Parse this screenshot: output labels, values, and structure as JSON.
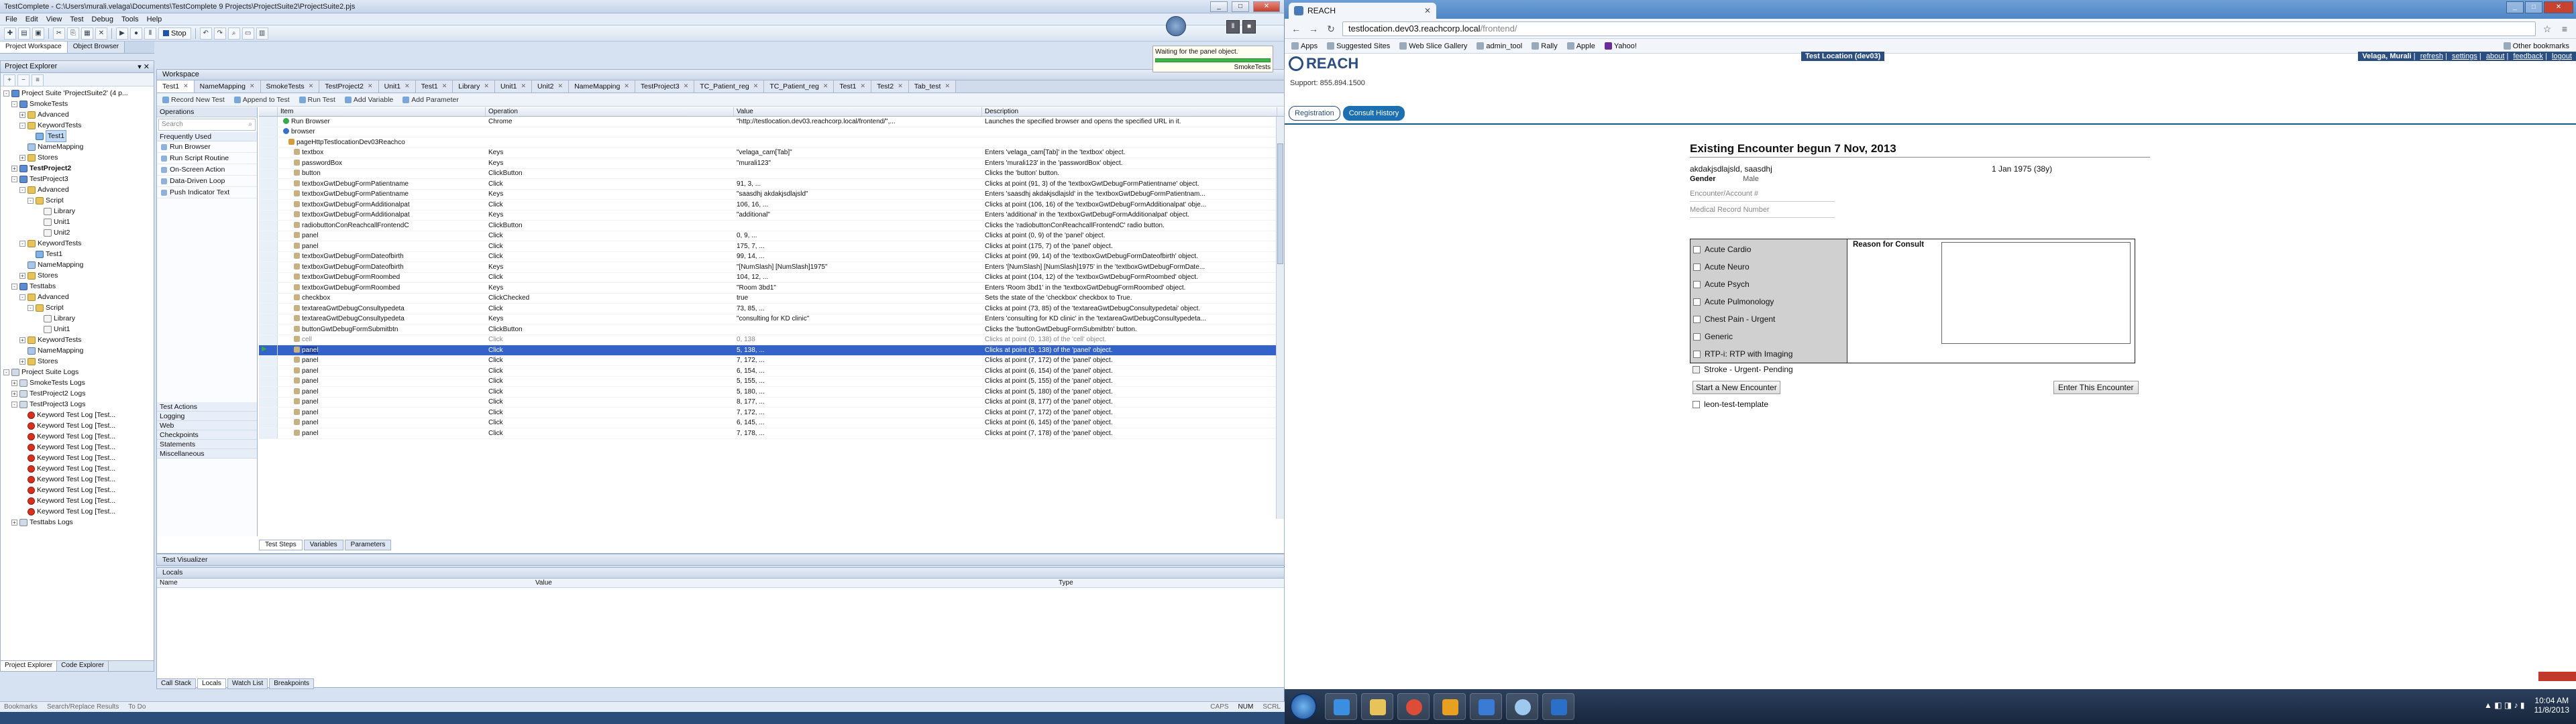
{
  "tc": {
    "title": "TestComplete - C:\\Users\\murali.velaga\\Documents\\TestComplete 9 Projects\\ProjectSuite2\\ProjectSuite2.pjs",
    "menus": [
      "File",
      "Edit",
      "View",
      "Test",
      "Debug",
      "Tools",
      "Help"
    ],
    "stop_label": "Stop",
    "panel_tabs": [
      "Project Workspace",
      "Object Browser"
    ],
    "explorer_title": "Project Explorer",
    "tree": [
      {
        "label": "Project Suite 'ProjectSuite2' (4 p...",
        "ic": "proj",
        "lvl": 0,
        "tw": "-"
      },
      {
        "label": "SmokeTests",
        "ic": "proj",
        "lvl": 1,
        "tw": "-"
      },
      {
        "label": "Advanced",
        "ic": "folder",
        "lvl": 2,
        "tw": "+"
      },
      {
        "label": "KeywordTests",
        "ic": "folder",
        "lvl": 2,
        "tw": "-"
      },
      {
        "label": "Test1",
        "ic": "kw",
        "lvl": 3,
        "tw": "",
        "sel": true
      },
      {
        "label": "NameMapping",
        "ic": "nm",
        "lvl": 2,
        "tw": ""
      },
      {
        "label": "Stores",
        "ic": "folder",
        "lvl": 2,
        "tw": "+"
      },
      {
        "label": "TestProject2",
        "ic": "proj",
        "lvl": 1,
        "tw": "+",
        "bold": true
      },
      {
        "label": "TestProject3",
        "ic": "proj",
        "lvl": 1,
        "tw": "-"
      },
      {
        "label": "Advanced",
        "ic": "folder",
        "lvl": 2,
        "tw": "-"
      },
      {
        "label": "Script",
        "ic": "folder",
        "lvl": 3,
        "tw": "-"
      },
      {
        "label": "Library",
        "ic": "script",
        "lvl": 4,
        "tw": ""
      },
      {
        "label": "Unit1",
        "ic": "script",
        "lvl": 4,
        "tw": ""
      },
      {
        "label": "Unit2",
        "ic": "script",
        "lvl": 4,
        "tw": ""
      },
      {
        "label": "KeywordTests",
        "ic": "folder",
        "lvl": 2,
        "tw": "-"
      },
      {
        "label": "Test1",
        "ic": "kw",
        "lvl": 3,
        "tw": ""
      },
      {
        "label": "NameMapping",
        "ic": "nm",
        "lvl": 2,
        "tw": ""
      },
      {
        "label": "Stores",
        "ic": "folder",
        "lvl": 2,
        "tw": "+"
      },
      {
        "label": "Testtabs",
        "ic": "proj",
        "lvl": 1,
        "tw": "-"
      },
      {
        "label": "Advanced",
        "ic": "folder",
        "lvl": 2,
        "tw": "-"
      },
      {
        "label": "Script",
        "ic": "folder",
        "lvl": 3,
        "tw": "-"
      },
      {
        "label": "Library",
        "ic": "script",
        "lvl": 4,
        "tw": ""
      },
      {
        "label": "Unit1",
        "ic": "script",
        "lvl": 4,
        "tw": ""
      },
      {
        "label": "KeywordTests",
        "ic": "folder",
        "lvl": 2,
        "tw": "+"
      },
      {
        "label": "NameMapping",
        "ic": "nm",
        "lvl": 2,
        "tw": ""
      },
      {
        "label": "Stores",
        "ic": "folder",
        "lvl": 2,
        "tw": "+"
      },
      {
        "label": "Project Suite Logs",
        "ic": "log",
        "lvl": 0,
        "tw": "-"
      },
      {
        "label": "SmokeTests Logs",
        "ic": "log",
        "lvl": 1,
        "tw": "+"
      },
      {
        "label": "TestProject2 Logs",
        "ic": "log",
        "lvl": 1,
        "tw": "+"
      },
      {
        "label": "TestProject3 Logs",
        "ic": "log",
        "lvl": 1,
        "tw": "-"
      },
      {
        "label": "Keyword Test Log [Test...",
        "ic": "err",
        "lvl": 2,
        "tw": ""
      },
      {
        "label": "Keyword Test Log [Test...",
        "ic": "err",
        "lvl": 2,
        "tw": ""
      },
      {
        "label": "Keyword Test Log [Test...",
        "ic": "err",
        "lvl": 2,
        "tw": ""
      },
      {
        "label": "Keyword Test Log [Test...",
        "ic": "err",
        "lvl": 2,
        "tw": ""
      },
      {
        "label": "Keyword Test Log [Test...",
        "ic": "err",
        "lvl": 2,
        "tw": ""
      },
      {
        "label": "Keyword Test Log [Test...",
        "ic": "err",
        "lvl": 2,
        "tw": ""
      },
      {
        "label": "Keyword Test Log [Test...",
        "ic": "err",
        "lvl": 2,
        "tw": ""
      },
      {
        "label": "Keyword Test Log [Test...",
        "ic": "err",
        "lvl": 2,
        "tw": ""
      },
      {
        "label": "Keyword Test Log [Test...",
        "ic": "err",
        "lvl": 2,
        "tw": ""
      },
      {
        "label": "Keyword Test Log [Test...",
        "ic": "err",
        "lvl": 2,
        "tw": ""
      },
      {
        "label": "Testtabs Logs",
        "ic": "log",
        "lvl": 1,
        "tw": "+"
      }
    ],
    "left_bottom_tabs": [
      "Project Explorer",
      "Code Explorer"
    ],
    "workspace_title": "Workspace",
    "doc_tabs": [
      "Test1",
      "NameMapping",
      "SmokeTests",
      "TestProject2",
      "Unit1",
      "Test1",
      "Library",
      "Unit1",
      "Unit2",
      "NameMapping",
      "TestProject3",
      "TC_Patient_reg",
      "TC_Patient_reg",
      "Test1",
      "Test2",
      "Tab_test"
    ],
    "kw_toolbar": [
      "Record New Test",
      "Append to Test",
      "Run Test",
      "Add Variable",
      "Add Parameter"
    ],
    "operations_title": "Operations",
    "search_placeholder": "Search",
    "operations": [
      "Frequently Used",
      "Run Browser",
      "Run Script Routine",
      "On-Screen Action",
      "Data-Driven Loop",
      "Push Indicator Text"
    ],
    "op_categories": [
      "Test Actions",
      "Logging",
      "Web",
      "Checkpoints",
      "Statements",
      "Miscellaneous"
    ],
    "grid_headers": [
      "Item",
      "Operation",
      "Value",
      "Description"
    ],
    "rows": [
      {
        "item": "Run Browser",
        "op": "Chrome",
        "val": "\"http://testlocation.dev03.reachcorp.local/frontend/\",...",
        "desc": "Launches the specified browser and opens the specified URL in it.",
        "lvl": 1,
        "ic": "grn"
      },
      {
        "item": "browser",
        "op": "",
        "val": "",
        "desc": "",
        "lvl": 1,
        "ic": "blu"
      },
      {
        "item": "pageHttpTestlocationDev03Reachco",
        "op": "",
        "val": "",
        "desc": "",
        "lvl": 2,
        "ic": "obj"
      },
      {
        "item": "textbox",
        "op": "Keys",
        "val": "\"velaga_cam[Tab]\"",
        "desc": "Enters 'velaga_cam[Tab]' in the 'textbox' object.",
        "lvl": 3
      },
      {
        "item": "passwordBox",
        "op": "Keys",
        "val": "\"murali123\"",
        "desc": "Enters 'murali123' in the 'passwordBox' object.",
        "lvl": 3
      },
      {
        "item": "button",
        "op": "ClickButton",
        "val": "",
        "desc": "Clicks the 'button' button.",
        "lvl": 3
      },
      {
        "item": "textboxGwtDebugFormPatientname",
        "op": "Click",
        "val": "91, 3, ...",
        "desc": "Clicks at point (91, 3) of the 'textboxGwtDebugFormPatientname' object.",
        "lvl": 3
      },
      {
        "item": "textboxGwtDebugFormPatientname",
        "op": "Keys",
        "val": "\"saasdhj akdakjsdlajsld\"",
        "desc": "Enters 'saasdhj akdakjsdlajsld' in the 'textboxGwtDebugFormPatientnam...",
        "lvl": 3
      },
      {
        "item": "textboxGwtDebugFormAdditionalpat",
        "op": "Click",
        "val": "106, 16, ...",
        "desc": "Clicks at point (106, 16) of the 'textboxGwtDebugFormAdditionalpat' obje...",
        "lvl": 3
      },
      {
        "item": "textboxGwtDebugFormAdditionalpat",
        "op": "Keys",
        "val": "\"additional\"",
        "desc": "Enters 'additional' in the 'textboxGwtDebugFormAdditionalpat' object.",
        "lvl": 3
      },
      {
        "item": "radiobuttonConReachcallFrontendC",
        "op": "ClickButton",
        "val": "",
        "desc": "Clicks the 'radiobuttonConReachcallFrontendC' radio button.",
        "lvl": 3
      },
      {
        "item": "panel",
        "op": "Click",
        "val": "0, 9, ...",
        "desc": "Clicks at point (0, 9) of the 'panel' object.",
        "lvl": 3
      },
      {
        "item": "panel",
        "op": "Click",
        "val": "175, 7, ...",
        "desc": "Clicks at point (175, 7) of the 'panel' object.",
        "lvl": 3
      },
      {
        "item": "textboxGwtDebugFormDateofbirth",
        "op": "Click",
        "val": "99, 14, ...",
        "desc": "Clicks at point (99, 14) of the 'textboxGwtDebugFormDateofbirth' object.",
        "lvl": 3
      },
      {
        "item": "textboxGwtDebugFormDateofbirth",
        "op": "Keys",
        "val": "\"[NumSlash] [NumSlash]1975\"",
        "desc": "Enters '[NumSlash] [NumSlash]1975' in the 'textboxGwtDebugFormDate...",
        "lvl": 3
      },
      {
        "item": "textboxGwtDebugFormRoombed",
        "op": "Click",
        "val": "104, 12, ...",
        "desc": "Clicks at point (104, 12) of the 'textboxGwtDebugFormRoombed' object.",
        "lvl": 3
      },
      {
        "item": "textboxGwtDebugFormRoombed",
        "op": "Keys",
        "val": "\"Room 3bd1\"",
        "desc": "Enters 'Room 3bd1' in the 'textboxGwtDebugFormRoombed' object.",
        "lvl": 3
      },
      {
        "item": "checkbox",
        "op": "ClickChecked",
        "val": "true",
        "desc": "Sets the state of the 'checkbox' checkbox to True.",
        "lvl": 3
      },
      {
        "item": "textareaGwtDebugConsultypedeta",
        "op": "Click",
        "val": "73, 85, ...",
        "desc": "Clicks at point (73, 85) of the 'textareaGwtDebugConsultypedetai' object.",
        "lvl": 3
      },
      {
        "item": "textareaGwtDebugConsultypedeta",
        "op": "Keys",
        "val": "\"consulting for KD clinic\"",
        "desc": "Enters 'consulting for KD clinic' in the 'textareaGwtDebugConsultypedeta...",
        "lvl": 3
      },
      {
        "item": "buttonGwtDebugFormSubmitbtn",
        "op": "ClickButton",
        "val": "",
        "desc": "Clicks the 'buttonGwtDebugFormSubmitbtn' button.",
        "lvl": 3
      },
      {
        "item": "cell",
        "op": "Click",
        "val": "0, 138",
        "desc": "Clicks at point (0, 138) of the 'cell' object.",
        "lvl": 3,
        "dim": true
      },
      {
        "item": "panel",
        "op": "Click",
        "val": "5, 138, ...",
        "desc": "Clicks at point (5, 138) of the 'panel' object.",
        "lvl": 3,
        "sel": true
      },
      {
        "item": "panel",
        "op": "Click",
        "val": "7, 172, ...",
        "desc": "Clicks at point (7, 172) of the 'panel' object.",
        "lvl": 3
      },
      {
        "item": "panel",
        "op": "Click",
        "val": "6, 154, ...",
        "desc": "Clicks at point (6, 154) of the 'panel' object.",
        "lvl": 3
      },
      {
        "item": "panel",
        "op": "Click",
        "val": "5, 155, ...",
        "desc": "Clicks at point (5, 155) of the 'panel' object.",
        "lvl": 3
      },
      {
        "item": "panel",
        "op": "Click",
        "val": "5, 180, ...",
        "desc": "Clicks at point (5, 180) of the 'panel' object.",
        "lvl": 3
      },
      {
        "item": "panel",
        "op": "Click",
        "val": "8, 177, ...",
        "desc": "Clicks at point (8, 177) of the 'panel' object.",
        "lvl": 3
      },
      {
        "item": "panel",
        "op": "Click",
        "val": "7, 172, ...",
        "desc": "Clicks at point (7, 172) of the 'panel' object.",
        "lvl": 3
      },
      {
        "item": "panel",
        "op": "Click",
        "val": "6, 145, ...",
        "desc": "Clicks at point (6, 145) of the 'panel' object.",
        "lvl": 3
      },
      {
        "item": "panel",
        "op": "Click",
        "val": "7, 178, ...",
        "desc": "Clicks at point (7, 178) of the 'panel' object.",
        "lvl": 3
      }
    ],
    "ws_bottom_tabs": [
      "Test Steps",
      "Variables",
      "Parameters"
    ],
    "visualizer_title": "Test Visualizer",
    "locals_title": "Locals",
    "locals_headers": [
      "Name",
      "Value",
      "Type"
    ],
    "bottom_tabs": [
      "Call Stack",
      "Locals",
      "Watch List",
      "Breakpoints"
    ],
    "status": [
      "Bookmarks",
      "Search/Replace Results",
      "To Do",
      "CAPS",
      "NUM",
      "SCRL"
    ],
    "waiting_msg": "Waiting for the panel object.",
    "running_label": "SmokeTests"
  },
  "chrome": {
    "tab_title": "REACH",
    "url_host": "testlocation.dev03.reachcorp.local",
    "url_path": "/frontend/",
    "bookmarks": [
      "Apps",
      "Suggested Sites",
      "Web Slice Gallery",
      "admin_tool",
      "Rally",
      "Apple",
      "Yahoo!"
    ],
    "other_bookmarks": "Other bookmarks"
  },
  "reach": {
    "location_tag": "Test Location (dev03)",
    "user_name": "Velaga, Murali",
    "user_links": [
      "refresh",
      "settings",
      "about",
      "feedback",
      "logout"
    ],
    "logo_text": "REACH",
    "support": "Support: 855.894.1500",
    "tabs": [
      "Registration",
      "Consult History"
    ],
    "encounter_title": "Existing Encounter begun 7 Nov, 2013",
    "patient_name": "akdakjsdlajsld, saasdhj",
    "dob": "1 Jan 1975 (38y)",
    "gender_label": "Gender",
    "gender_value": "Male",
    "account_placeholder": "Encounter/Account #",
    "mrn_placeholder": "Medical Record Number",
    "consult_types": [
      "Acute Cardio",
      "Acute Neuro",
      "Acute Psych",
      "Acute Pulmonology",
      "Chest Pain - Urgent",
      "Generic",
      "RTP-i: RTP with Imaging"
    ],
    "reason_label": "Reason for Consult",
    "stroke_label": "Stroke - Urgent- Pending",
    "start_new": "Start a New Encounter",
    "enter_encounter": "Enter This Encounter",
    "template_label": "leon-test-template"
  },
  "taskbar": {
    "time": "10:04 AM",
    "date": "11/8/2013"
  }
}
